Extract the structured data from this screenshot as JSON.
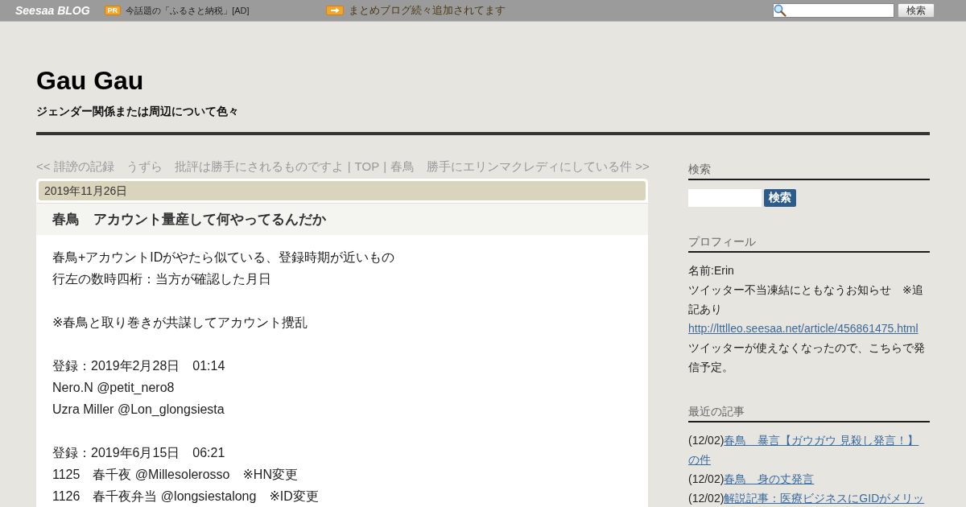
{
  "top_bar": {
    "logo": "Seesaa BLOG",
    "ad": {
      "badge": "PR",
      "text": "今話題の「ふるさと納税」[AD]"
    },
    "promo": {
      "text": "まとめブログ続々追加されてます"
    },
    "search": {
      "button": "検索"
    }
  },
  "blog": {
    "title": "Gau Gau",
    "subtitle": "ジェンダー関係または周辺について色々"
  },
  "article_nav": {
    "links": [
      "<< 誹謗の記録　うずら　批評は勝手にされるものですよ",
      "TOP",
      "春鳥　勝手にエリンマクレディにしている件 >>"
    ],
    "separators": [
      "|",
      "|"
    ]
  },
  "entry": {
    "date": "2019年11月26日",
    "title": "春鳥　アカウント量産して何やってるんだか",
    "paragraphs": [
      [
        "春鳥+アカウントIDがやたら似ている、登録時期が近いもの",
        "行左の数時四桁：当方が確認した月日"
      ],
      [
        "※春鳥と取り巻きが共謀してアカウント攪乱"
      ],
      [
        "登録：2019年2月28日　01:14",
        "Nero.N @petit_nero8",
        "Uzra Miller @Lon_glongsiesta"
      ],
      [
        "登録：2019年6月15日　06:21",
        "1125　春千夜 @Millesolerosso　※HN変更",
        "1126　春千夜弁当 @longsiestalong　※ID変更"
      ]
    ]
  },
  "sidebar": [
    {
      "kind": "search",
      "heading": "検索",
      "button": "検索"
    },
    {
      "kind": "profile",
      "heading": "プロフィール",
      "items": [
        {
          "kind": "text",
          "text": "名前:Erin"
        },
        {
          "kind": "text",
          "text": "ツイッター不当凍結にともなうお知らせ　※追記あり"
        },
        {
          "kind": "link",
          "text": "http://lttlleo.seesaa.net/article/456861475.html"
        },
        {
          "kind": "text",
          "text": "ツイッターが使えなくなったので、こちらで発信予定。"
        }
      ]
    },
    {
      "kind": "recent",
      "heading": "最近の記事",
      "items": [
        {
          "date": "(12/02)",
          "title": "春鳥　暴言【ガウガウ 見殺し発言！】の件"
        },
        {
          "date": "(12/02)",
          "title": "春鳥　身の丈発言"
        },
        {
          "date": "(12/02)",
          "title": "解説記事：医療ビジネスにGIDがメリッ"
        }
      ]
    }
  ]
}
